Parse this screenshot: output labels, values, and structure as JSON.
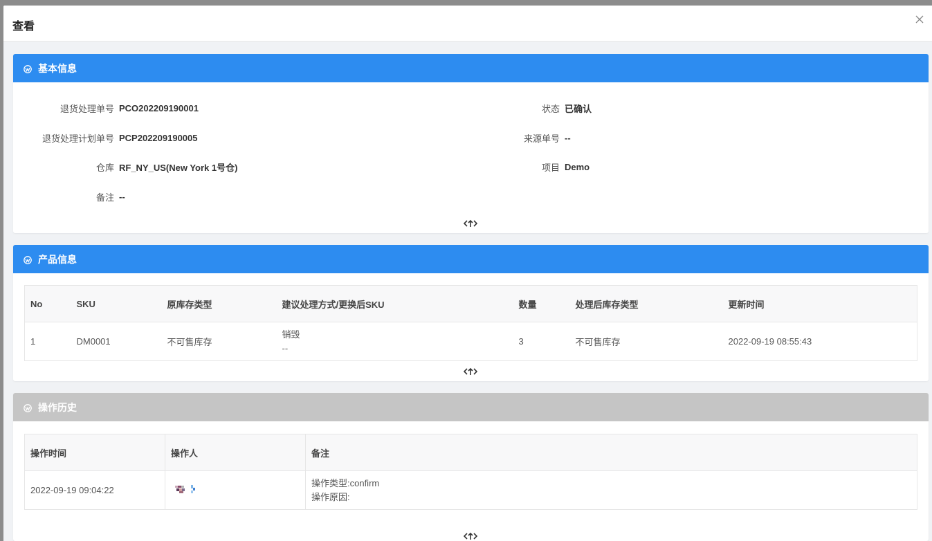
{
  "dialog": {
    "title": "查看"
  },
  "basic_info": {
    "title": "基本信息",
    "fields_left": [
      {
        "label": "退货处理单号",
        "value": "PCO202209190001"
      },
      {
        "label": "退货处理计划单号",
        "value": "PCP202209190005"
      },
      {
        "label": "仓库",
        "value": "RF_NY_US(New York 1号仓)"
      },
      {
        "label": "备注",
        "value": "--"
      }
    ],
    "fields_right": [
      {
        "label": "状态",
        "value": "已确认"
      },
      {
        "label": "来源单号",
        "value": "--"
      },
      {
        "label": "项目",
        "value": "Demo"
      }
    ]
  },
  "product_info": {
    "title": "产品信息",
    "columns": [
      "No",
      "SKU",
      "原库存类型",
      "建议处理方式/更换后SKU",
      "数量",
      "处理后库存类型",
      "更新时间"
    ],
    "rows": [
      {
        "no": "1",
        "sku": "DM0001",
        "original_stock_type": "不可售库存",
        "suggested_method": "销毁",
        "replacement_sku": "--",
        "quantity": "3",
        "processed_stock_type": "不可售库存",
        "updated_at": "2022-09-19 08:55:43"
      }
    ]
  },
  "history": {
    "title": "操作历史",
    "columns": [
      "操作时间",
      "操作人",
      "备注"
    ],
    "rows": [
      {
        "time": "2022-09-19 09:04:22",
        "operator": "",
        "note_line1": "操作类型:confirm",
        "note_line2": "操作原因:"
      }
    ]
  },
  "colors": {
    "header_blue": "#2d8cf0",
    "header_gray": "#c5c5c5"
  },
  "icons": {
    "close": "close-icon",
    "section": "wordpress-icon",
    "collapse": "collapse-toggle-icon"
  }
}
